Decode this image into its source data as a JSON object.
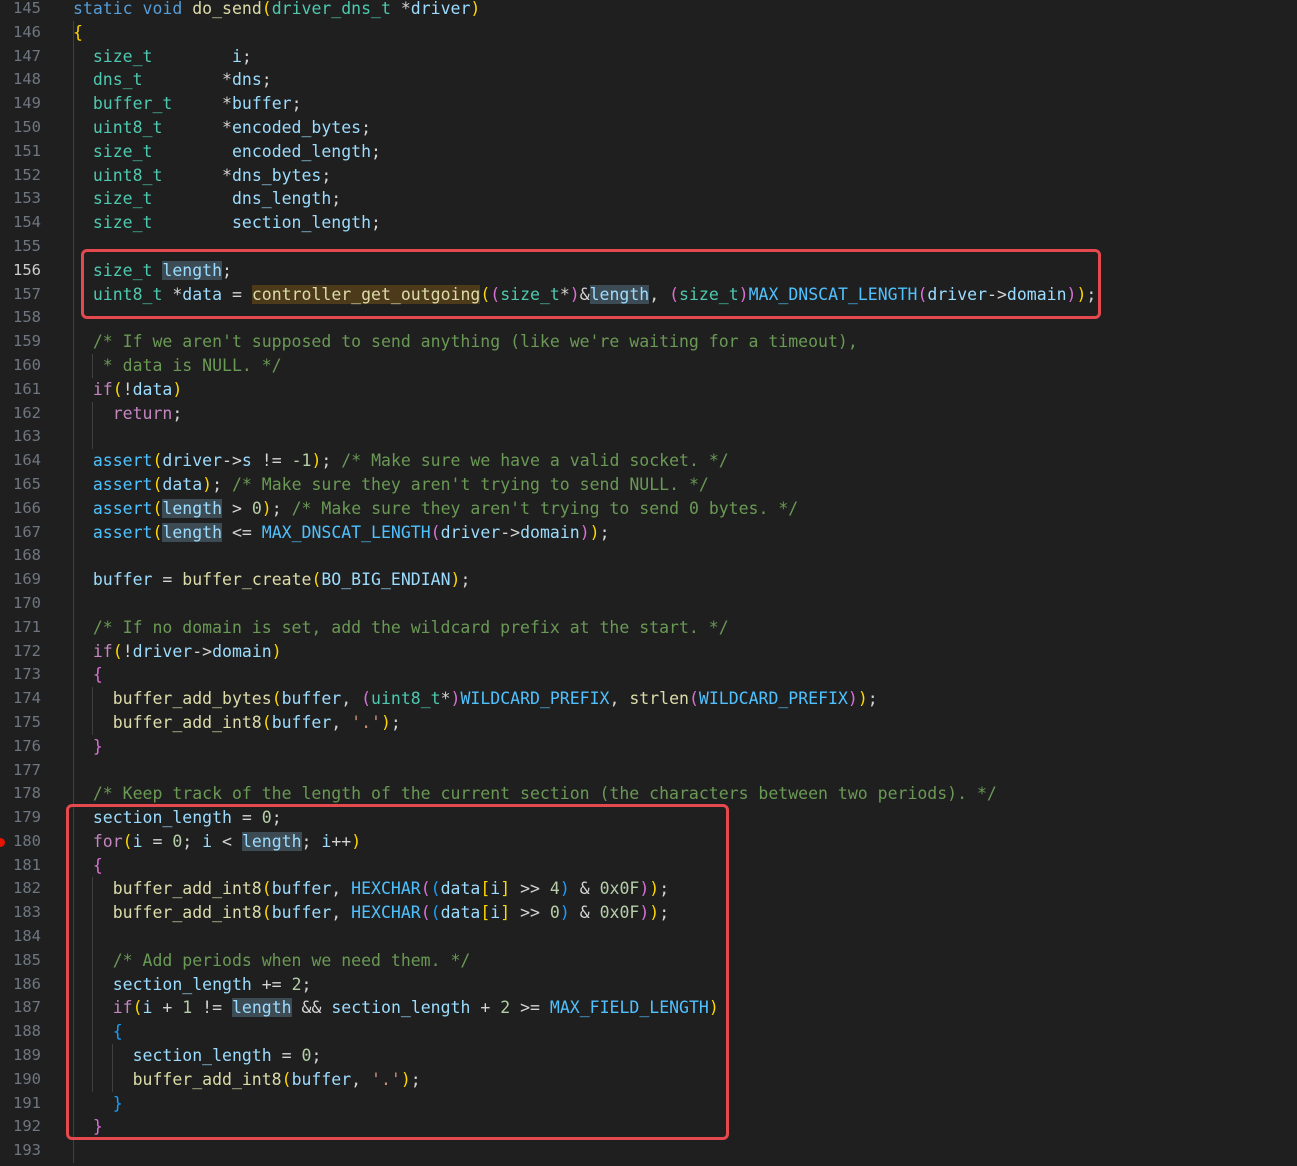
{
  "editor": {
    "active_line": 156,
    "breakpoint_line": 180,
    "lines": [
      {
        "n": 145,
        "t": [
          [
            "kw",
            "static "
          ],
          [
            "kw",
            "void "
          ],
          [
            "fn",
            "do_send"
          ],
          [
            "b1",
            "("
          ],
          [
            "ty",
            "driver_dns_t "
          ],
          [
            "op",
            "*"
          ],
          [
            "var",
            "driver"
          ],
          [
            "b1",
            ")"
          ]
        ]
      },
      {
        "n": 146,
        "t": [
          [
            "b1",
            "{"
          ]
        ]
      },
      {
        "n": 147,
        "t": [
          [
            "ty",
            "  size_t        "
          ],
          [
            "var",
            "i"
          ],
          [
            "op",
            ";"
          ]
        ]
      },
      {
        "n": 148,
        "t": [
          [
            "ty",
            "  dns_t        "
          ],
          [
            "op",
            "*"
          ],
          [
            "var",
            "dns"
          ],
          [
            "op",
            ";"
          ]
        ]
      },
      {
        "n": 149,
        "t": [
          [
            "ty",
            "  buffer_t     "
          ],
          [
            "op",
            "*"
          ],
          [
            "var",
            "buffer"
          ],
          [
            "op",
            ";"
          ]
        ]
      },
      {
        "n": 150,
        "t": [
          [
            "ty",
            "  uint8_t      "
          ],
          [
            "op",
            "*"
          ],
          [
            "var",
            "encoded_bytes"
          ],
          [
            "op",
            ";"
          ]
        ]
      },
      {
        "n": 151,
        "t": [
          [
            "ty",
            "  size_t        "
          ],
          [
            "var",
            "encoded_length"
          ],
          [
            "op",
            ";"
          ]
        ]
      },
      {
        "n": 152,
        "t": [
          [
            "ty",
            "  uint8_t      "
          ],
          [
            "op",
            "*"
          ],
          [
            "var",
            "dns_bytes"
          ],
          [
            "op",
            ";"
          ]
        ]
      },
      {
        "n": 153,
        "t": [
          [
            "ty",
            "  size_t        "
          ],
          [
            "var",
            "dns_length"
          ],
          [
            "op",
            ";"
          ]
        ]
      },
      {
        "n": 154,
        "t": [
          [
            "ty",
            "  size_t        "
          ],
          [
            "var",
            "section_length"
          ],
          [
            "op",
            ";"
          ]
        ]
      },
      {
        "n": 155,
        "t": []
      },
      {
        "n": 156,
        "t": [
          [
            "ty",
            "  size_t "
          ],
          [
            "var hl",
            "length"
          ],
          [
            "op",
            ";"
          ]
        ]
      },
      {
        "n": 157,
        "t": [
          [
            "ty",
            "  uint8_t "
          ],
          [
            "op",
            "*"
          ],
          [
            "var",
            "data"
          ],
          [
            "op",
            " = "
          ],
          [
            "fn hlf",
            "controller_get_outgoing"
          ],
          [
            "b1",
            "("
          ],
          [
            "b2",
            "("
          ],
          [
            "ty",
            "size_t"
          ],
          [
            "op",
            "*"
          ],
          [
            "b2",
            ")"
          ],
          [
            "op",
            "&"
          ],
          [
            "var hl",
            "length"
          ],
          [
            "op",
            ", "
          ],
          [
            "b2",
            "("
          ],
          [
            "ty",
            "size_t"
          ],
          [
            "b2",
            ")"
          ],
          [
            "mac",
            "MAX_DNSCAT_LENGTH"
          ],
          [
            "b2",
            "("
          ],
          [
            "var",
            "driver"
          ],
          [
            "op",
            "->"
          ],
          [
            "var",
            "domain"
          ],
          [
            "b2",
            ")"
          ],
          [
            "b1",
            ")"
          ],
          [
            "op",
            ";"
          ]
        ]
      },
      {
        "n": 158,
        "t": []
      },
      {
        "n": 159,
        "t": [
          [
            "cm",
            "  /* If we aren't supposed to send anything (like we're waiting for a timeout),"
          ]
        ]
      },
      {
        "n": 160,
        "t": [
          [
            "cm",
            "   * data is NULL. */"
          ]
        ]
      },
      {
        "n": 161,
        "t": [
          [
            "ctl",
            "  if"
          ],
          [
            "b1",
            "("
          ],
          [
            "op",
            "!"
          ],
          [
            "var",
            "data"
          ],
          [
            "b1",
            ")"
          ]
        ]
      },
      {
        "n": 162,
        "t": [
          [
            "ctl",
            "    return"
          ],
          [
            "op",
            ";"
          ]
        ]
      },
      {
        "n": 163,
        "t": []
      },
      {
        "n": 164,
        "t": [
          [
            "mac",
            "  assert"
          ],
          [
            "b1",
            "("
          ],
          [
            "var",
            "driver"
          ],
          [
            "op",
            "->"
          ],
          [
            "var",
            "s"
          ],
          [
            "op",
            " != "
          ],
          [
            "num",
            "-1"
          ],
          [
            "b1",
            ")"
          ],
          [
            "op",
            "; "
          ],
          [
            "cm",
            "/* Make sure we have a valid socket. */"
          ]
        ]
      },
      {
        "n": 165,
        "t": [
          [
            "mac",
            "  assert"
          ],
          [
            "b1",
            "("
          ],
          [
            "var",
            "data"
          ],
          [
            "b1",
            ")"
          ],
          [
            "op",
            "; "
          ],
          [
            "cm",
            "/* Make sure they aren't trying to send NULL. */"
          ]
        ]
      },
      {
        "n": 166,
        "t": [
          [
            "mac",
            "  assert"
          ],
          [
            "b1",
            "("
          ],
          [
            "var hl",
            "length"
          ],
          [
            "op",
            " > "
          ],
          [
            "num",
            "0"
          ],
          [
            "b1",
            ")"
          ],
          [
            "op",
            "; "
          ],
          [
            "cm",
            "/* Make sure they aren't trying to send 0 bytes. */"
          ]
        ]
      },
      {
        "n": 167,
        "t": [
          [
            "mac",
            "  assert"
          ],
          [
            "b1",
            "("
          ],
          [
            "var hl",
            "length"
          ],
          [
            "op",
            " <= "
          ],
          [
            "mac",
            "MAX_DNSCAT_LENGTH"
          ],
          [
            "b2",
            "("
          ],
          [
            "var",
            "driver"
          ],
          [
            "op",
            "->"
          ],
          [
            "var",
            "domain"
          ],
          [
            "b2",
            ")"
          ],
          [
            "b1",
            ")"
          ],
          [
            "op",
            ";"
          ]
        ]
      },
      {
        "n": 168,
        "t": []
      },
      {
        "n": 169,
        "t": [
          [
            "var",
            "  buffer"
          ],
          [
            "op",
            " = "
          ],
          [
            "fn",
            "buffer_create"
          ],
          [
            "b1",
            "("
          ],
          [
            "var",
            "BO_BIG_ENDIAN"
          ],
          [
            "b1",
            ")"
          ],
          [
            "op",
            ";"
          ]
        ]
      },
      {
        "n": 170,
        "t": []
      },
      {
        "n": 171,
        "t": [
          [
            "cm",
            "  /* If no domain is set, add the wildcard prefix at the start. */"
          ]
        ]
      },
      {
        "n": 172,
        "t": [
          [
            "ctl",
            "  if"
          ],
          [
            "b1",
            "("
          ],
          [
            "op",
            "!"
          ],
          [
            "var",
            "driver"
          ],
          [
            "op",
            "->"
          ],
          [
            "var",
            "domain"
          ],
          [
            "b1",
            ")"
          ]
        ]
      },
      {
        "n": 173,
        "t": [
          [
            "b2",
            "  {"
          ]
        ]
      },
      {
        "n": 174,
        "t": [
          [
            "fn",
            "    buffer_add_bytes"
          ],
          [
            "b1",
            "("
          ],
          [
            "var",
            "buffer"
          ],
          [
            "op",
            ", "
          ],
          [
            "b2",
            "("
          ],
          [
            "ty",
            "uint8_t"
          ],
          [
            "op",
            "*"
          ],
          [
            "b2",
            ")"
          ],
          [
            "mac",
            "WILDCARD_PREFIX"
          ],
          [
            "op",
            ", "
          ],
          [
            "fn",
            "strlen"
          ],
          [
            "b2",
            "("
          ],
          [
            "mac",
            "WILDCARD_PREFIX"
          ],
          [
            "b2",
            ")"
          ],
          [
            "b1",
            ")"
          ],
          [
            "op",
            ";"
          ]
        ]
      },
      {
        "n": 175,
        "t": [
          [
            "fn",
            "    buffer_add_int8"
          ],
          [
            "b1",
            "("
          ],
          [
            "var",
            "buffer"
          ],
          [
            "op",
            ", "
          ],
          [
            "str",
            "'.'"
          ],
          [
            "b1",
            ")"
          ],
          [
            "op",
            ";"
          ]
        ]
      },
      {
        "n": 176,
        "t": [
          [
            "b2",
            "  }"
          ]
        ]
      },
      {
        "n": 177,
        "t": []
      },
      {
        "n": 178,
        "t": [
          [
            "cm",
            "  /* Keep track of the length of the current section (the characters between two periods). */"
          ]
        ]
      },
      {
        "n": 179,
        "t": [
          [
            "var",
            "  section_length"
          ],
          [
            "op",
            " = "
          ],
          [
            "num",
            "0"
          ],
          [
            "op",
            ";"
          ]
        ]
      },
      {
        "n": 180,
        "t": [
          [
            "ctl",
            "  for"
          ],
          [
            "b1",
            "("
          ],
          [
            "var",
            "i"
          ],
          [
            "op",
            " = "
          ],
          [
            "num",
            "0"
          ],
          [
            "op",
            "; "
          ],
          [
            "var",
            "i"
          ],
          [
            "op",
            " < "
          ],
          [
            "var hl",
            "length"
          ],
          [
            "op",
            "; "
          ],
          [
            "var",
            "i"
          ],
          [
            "op",
            "++"
          ],
          [
            "b1",
            ")"
          ]
        ]
      },
      {
        "n": 181,
        "t": [
          [
            "b2",
            "  {"
          ]
        ]
      },
      {
        "n": 182,
        "t": [
          [
            "fn",
            "    buffer_add_int8"
          ],
          [
            "b1",
            "("
          ],
          [
            "var",
            "buffer"
          ],
          [
            "op",
            ", "
          ],
          [
            "mac",
            "HEXCHAR"
          ],
          [
            "b2",
            "("
          ],
          [
            "b3",
            "("
          ],
          [
            "var",
            "data"
          ],
          [
            "b1",
            "["
          ],
          [
            "var",
            "i"
          ],
          [
            "b1",
            "]"
          ],
          [
            "op",
            " >> "
          ],
          [
            "num",
            "4"
          ],
          [
            "b3",
            ")"
          ],
          [
            "op",
            " & "
          ],
          [
            "num",
            "0x0F"
          ],
          [
            "b2",
            ")"
          ],
          [
            "b1",
            ")"
          ],
          [
            "op",
            ";"
          ]
        ]
      },
      {
        "n": 183,
        "t": [
          [
            "fn",
            "    buffer_add_int8"
          ],
          [
            "b1",
            "("
          ],
          [
            "var",
            "buffer"
          ],
          [
            "op",
            ", "
          ],
          [
            "mac",
            "HEXCHAR"
          ],
          [
            "b2",
            "("
          ],
          [
            "b3",
            "("
          ],
          [
            "var",
            "data"
          ],
          [
            "b1",
            "["
          ],
          [
            "var",
            "i"
          ],
          [
            "b1",
            "]"
          ],
          [
            "op",
            " >> "
          ],
          [
            "num",
            "0"
          ],
          [
            "b3",
            ")"
          ],
          [
            "op",
            " & "
          ],
          [
            "num",
            "0x0F"
          ],
          [
            "b2",
            ")"
          ],
          [
            "b1",
            ")"
          ],
          [
            "op",
            ";"
          ]
        ]
      },
      {
        "n": 184,
        "t": []
      },
      {
        "n": 185,
        "t": [
          [
            "cm",
            "    /* Add periods when we need them. */"
          ]
        ]
      },
      {
        "n": 186,
        "t": [
          [
            "var",
            "    section_length"
          ],
          [
            "op",
            " += "
          ],
          [
            "num",
            "2"
          ],
          [
            "op",
            ";"
          ]
        ]
      },
      {
        "n": 187,
        "t": [
          [
            "ctl",
            "    if"
          ],
          [
            "b1",
            "("
          ],
          [
            "var",
            "i"
          ],
          [
            "op",
            " + "
          ],
          [
            "num",
            "1"
          ],
          [
            "op",
            " != "
          ],
          [
            "var hl",
            "length"
          ],
          [
            "op",
            " && "
          ],
          [
            "var",
            "section_length"
          ],
          [
            "op",
            " + "
          ],
          [
            "num",
            "2"
          ],
          [
            "op",
            " >= "
          ],
          [
            "mac",
            "MAX_FIELD_LENGTH"
          ],
          [
            "b1",
            ")"
          ]
        ]
      },
      {
        "n": 188,
        "t": [
          [
            "b3",
            "    {"
          ]
        ]
      },
      {
        "n": 189,
        "t": [
          [
            "var",
            "      section_length"
          ],
          [
            "op",
            " = "
          ],
          [
            "num",
            "0"
          ],
          [
            "op",
            ";"
          ]
        ]
      },
      {
        "n": 190,
        "t": [
          [
            "fn",
            "      buffer_add_int8"
          ],
          [
            "b1",
            "("
          ],
          [
            "var",
            "buffer"
          ],
          [
            "op",
            ", "
          ],
          [
            "str",
            "'.'"
          ],
          [
            "b1",
            ")"
          ],
          [
            "op",
            ";"
          ]
        ]
      },
      {
        "n": 191,
        "t": [
          [
            "b3",
            "    }"
          ]
        ]
      },
      {
        "n": 192,
        "t": [
          [
            "b2",
            "  }"
          ]
        ]
      },
      {
        "n": 193,
        "t": []
      }
    ]
  },
  "colors": {
    "background": "#1f1f1f",
    "highlight_box": "#e5484d",
    "breakpoint": "#e51400"
  }
}
